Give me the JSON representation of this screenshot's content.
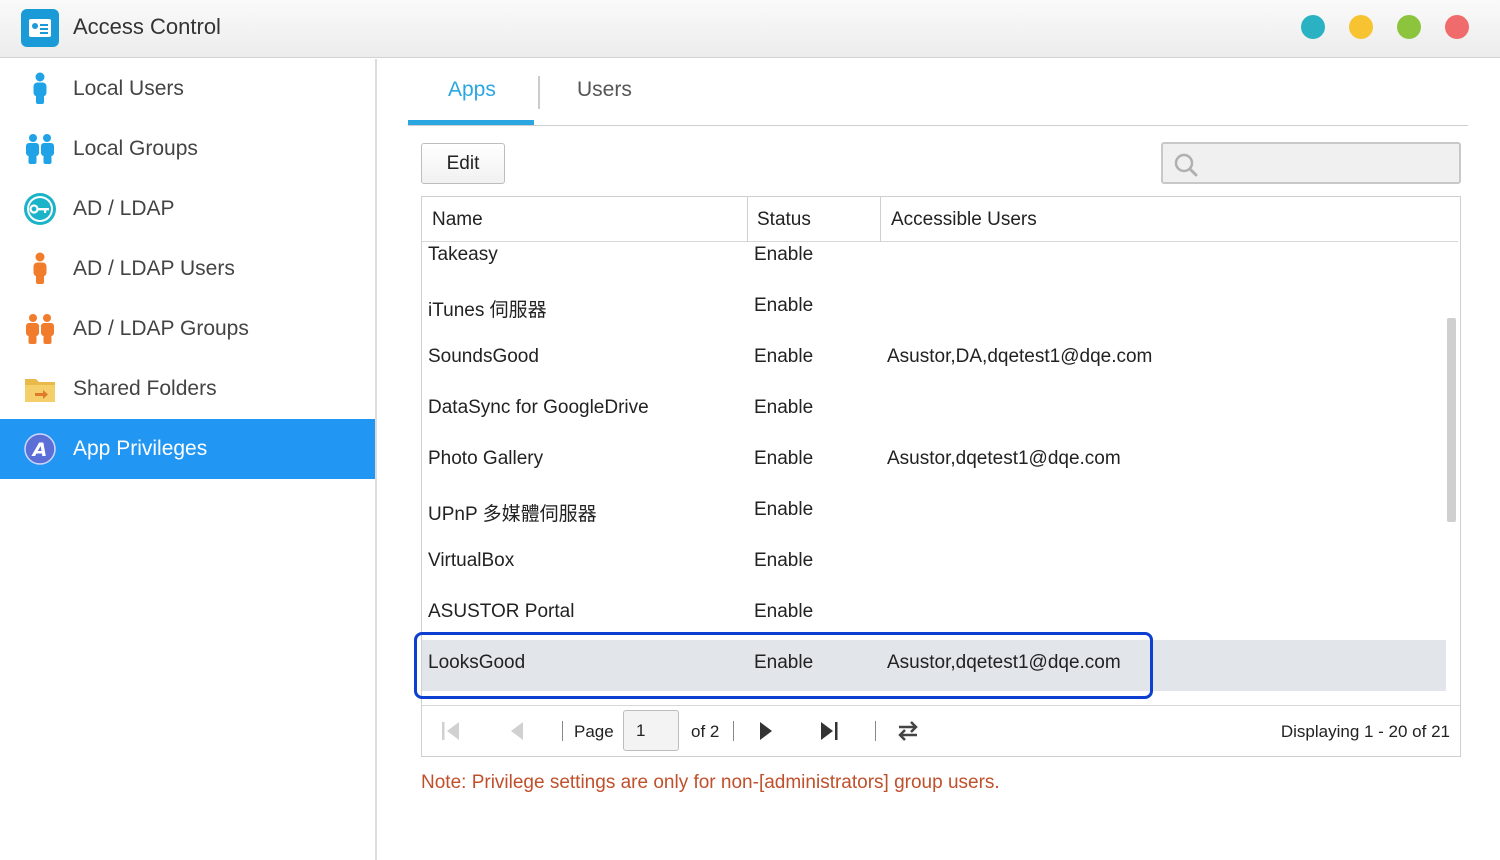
{
  "window": {
    "title": "Access Control"
  },
  "window_buttons": [
    "#2ab2c2",
    "#f7c331",
    "#8cc43d",
    "#f06b6b"
  ],
  "sidebar": {
    "items": [
      {
        "label": "Local Users",
        "icon": "person-icon",
        "active": false
      },
      {
        "label": "Local Groups",
        "icon": "group-icon",
        "active": false
      },
      {
        "label": "AD / LDAP",
        "icon": "key-icon",
        "active": false
      },
      {
        "label": "AD / LDAP Users",
        "icon": "person-icon",
        "active": false
      },
      {
        "label": "AD / LDAP Groups",
        "icon": "group-icon",
        "active": false
      },
      {
        "label": "Shared Folders",
        "icon": "folder-icon",
        "active": false
      },
      {
        "label": "App Privileges",
        "icon": "app-privileges-icon",
        "active": true
      }
    ]
  },
  "tabs": [
    {
      "label": "Apps",
      "active": true
    },
    {
      "label": "Users",
      "active": false
    }
  ],
  "toolbar": {
    "edit_label": "Edit",
    "search_placeholder": ""
  },
  "table": {
    "columns": [
      "Name",
      "Status",
      "Accessible Users"
    ],
    "rows": [
      {
        "name": "Takeasy",
        "status": "Enable",
        "users": ""
      },
      {
        "name": "iTunes 伺服器",
        "status": "Enable",
        "users": ""
      },
      {
        "name": "SoundsGood",
        "status": "Enable",
        "users": "Asustor,DA,dqetest1@dqe.com"
      },
      {
        "name": "DataSync for GoogleDrive",
        "status": "Enable",
        "users": ""
      },
      {
        "name": "Photo Gallery",
        "status": "Enable",
        "users": "Asustor,dqetest1@dqe.com"
      },
      {
        "name": "UPnP 多媒體伺服器",
        "status": "Enable",
        "users": ""
      },
      {
        "name": "VirtualBox",
        "status": "Enable",
        "users": ""
      },
      {
        "name": "ASUSTOR Portal",
        "status": "Enable",
        "users": ""
      },
      {
        "name": "LooksGood",
        "status": "Enable",
        "users": "Asustor,dqetest1@dqe.com",
        "selected": true
      }
    ]
  },
  "pager": {
    "page_label": "Page",
    "page_value": "1",
    "of_label": "of 2",
    "display_text": "Displaying 1 - 20 of 21"
  },
  "note": "Note: Privilege settings are only for non-[administrators] group users."
}
